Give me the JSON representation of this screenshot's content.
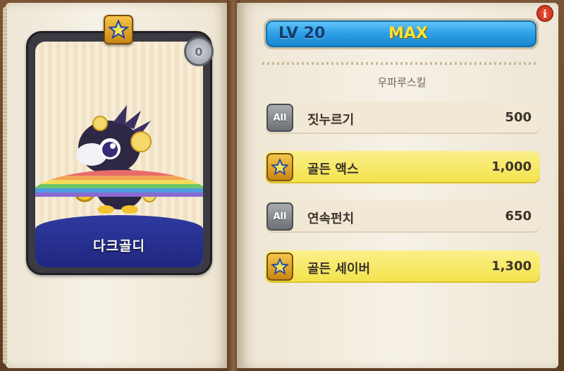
{
  "pet": {
    "name": "다크골디",
    "coin_symbol": "0"
  },
  "level": {
    "label": "LV 20",
    "status": "MAX"
  },
  "info_symbol": "i",
  "skills_heading": "우파루스킬",
  "skills": [
    {
      "badge": "All",
      "type": "all",
      "name": "짓누르기",
      "value": "500"
    },
    {
      "badge": "",
      "type": "star",
      "name": "골든 액스",
      "value": "1,000"
    },
    {
      "badge": "All",
      "type": "all",
      "name": "연속펀치",
      "value": "650"
    },
    {
      "badge": "",
      "type": "star",
      "name": "골든 세이버",
      "value": "1,300"
    }
  ],
  "colors": {
    "level_bar": "#2d9ee6",
    "gold_row": "#f3e24a",
    "max_text": "#ffe23a"
  }
}
